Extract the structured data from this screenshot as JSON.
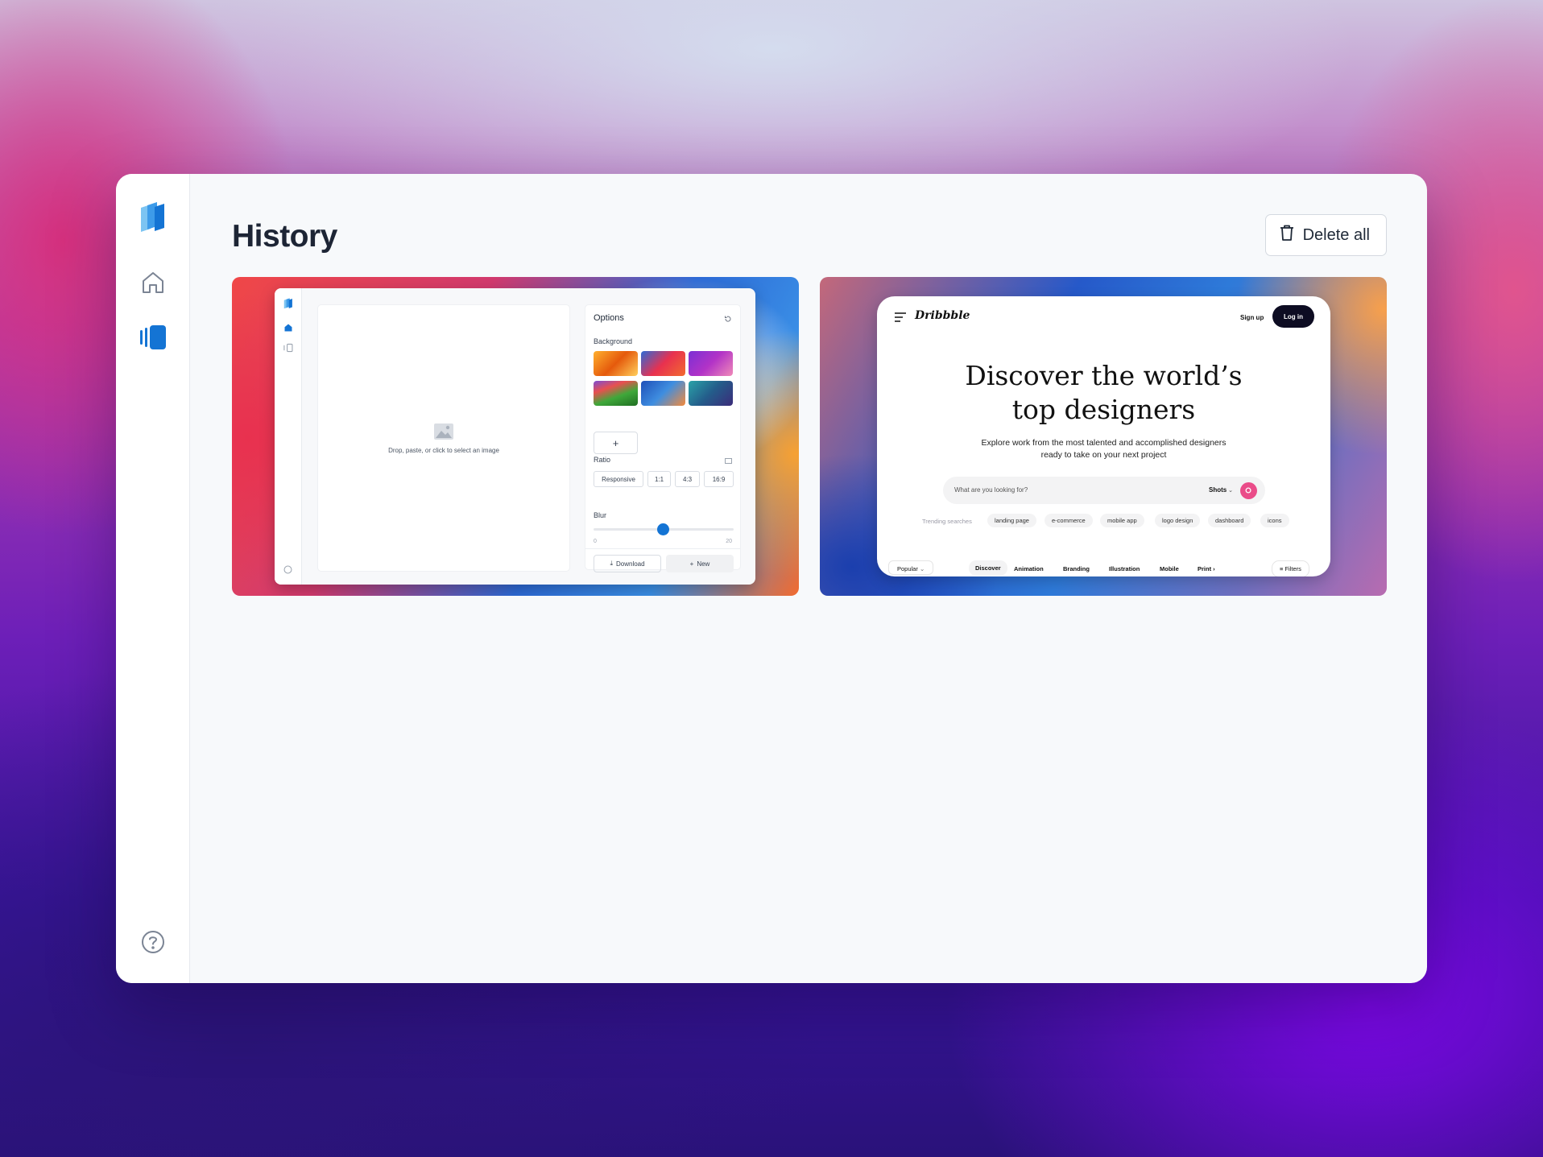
{
  "page": {
    "title": "History"
  },
  "toolbar": {
    "delete_all_label": "Delete all"
  },
  "sidebar": {
    "items": [
      {
        "name": "logo",
        "icon": "app-logo-icon"
      },
      {
        "name": "home",
        "icon": "home-icon"
      },
      {
        "name": "history",
        "icon": "history-stack-icon",
        "active": true
      },
      {
        "name": "help",
        "icon": "help-circle-icon"
      }
    ]
  },
  "colors": {
    "accent": "#1474d4",
    "title": "#1d2535",
    "dribbble_pink": "#ea4c89"
  },
  "history": [
    {
      "preview": "app-editor",
      "options_title": "Options",
      "background_label": "Background",
      "add_label": "+",
      "drop_text": "Drop, paste, or click to select an image",
      "ratio_label": "Ratio",
      "ratios": [
        "Responsive",
        "1:1",
        "4:3",
        "16:9"
      ],
      "blur_label": "Blur",
      "blur_min": "0",
      "blur_max": "20",
      "blur_value": 10,
      "download_label": "Download",
      "new_label": "New"
    },
    {
      "preview": "dribbble",
      "logo": "Dribbble",
      "signup": "Sign up",
      "login": "Log in",
      "hero_line1": "Discover the world’s",
      "hero_line2": "top designers",
      "sub_line1": "Explore work from the most talented and accomplished designers",
      "sub_line2": "ready to take on your next project",
      "search_placeholder": "What are you looking for?",
      "search_scope": "Shots",
      "trending_label": "Trending searches",
      "tags": [
        "landing page",
        "e-commerce",
        "mobile app",
        "logo design",
        "dashboard",
        "icons"
      ],
      "sort": "Popular",
      "nav": [
        "Discover",
        "Animation",
        "Branding",
        "Illustration",
        "Mobile",
        "Print"
      ],
      "filters": "Filters"
    }
  ]
}
